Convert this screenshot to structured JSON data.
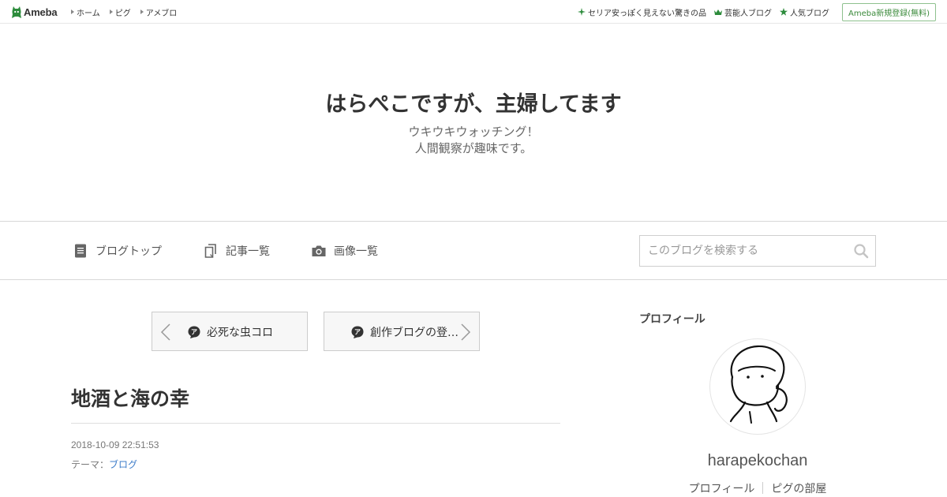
{
  "global_bar": {
    "logo_text": "Ameba",
    "left_links": [
      "ホーム",
      "ピグ",
      "アメブロ"
    ],
    "right_links": [
      {
        "icon": "sparkle-icon",
        "label": "セリア安っぽく見えない驚きの品"
      },
      {
        "icon": "crown-icon",
        "label": "芸能人ブログ"
      },
      {
        "icon": "star-icon",
        "label": "人気ブログ"
      }
    ],
    "register_label": "Ameba新規登録(無料)"
  },
  "blog": {
    "title": "はらぺこですが、主婦してます",
    "description_line1": "ウキウキウォッチング！",
    "description_line2": "人間観察が趣味です。"
  },
  "blog_nav": {
    "items": [
      {
        "icon": "document-icon",
        "label": "ブログトップ"
      },
      {
        "icon": "copy-icon",
        "label": "記事一覧"
      },
      {
        "icon": "camera-icon",
        "label": "画像一覧"
      }
    ],
    "search_placeholder": "このブログを検索する"
  },
  "pager": {
    "prev_title": "必死な虫コロ",
    "next_title": "創作ブログの登…"
  },
  "article": {
    "title": "地酒と海の幸",
    "date": "2018-10-09 22:51:53",
    "theme_label": "テーマ：",
    "theme_value": "ブログ"
  },
  "sidebar": {
    "heading": "プロフィール",
    "name": "harapekochan",
    "links": [
      "プロフィール",
      "ピグの部屋"
    ]
  },
  "colors": {
    "ameba_green": "#2d8c3c",
    "link_blue": "#3d7cc9",
    "register_border": "#8ec18e"
  }
}
